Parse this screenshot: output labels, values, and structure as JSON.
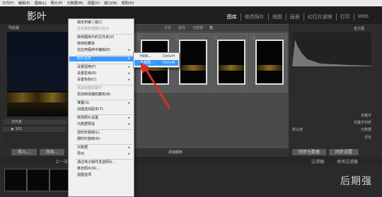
{
  "menubar": [
    "文件(F)",
    "编辑(E)",
    "图库(L)",
    "照片(P)",
    "元数据(M)",
    "视图(V)",
    "窗口(W)",
    "帮助(H)"
  ],
  "app_logo": "影叶",
  "modules": [
    {
      "label": "图库",
      "active": true
    },
    {
      "label": "修改照片",
      "active": false
    },
    {
      "label": "地图",
      "active": false
    },
    {
      "label": "画册",
      "active": false
    },
    {
      "label": "幻灯片放映",
      "active": false
    },
    {
      "label": "打印",
      "active": false
    },
    {
      "label": "Web",
      "active": false
    }
  ],
  "left_panel": {
    "navigator_title": "导航器",
    "folders_title": "文件夹",
    "folder_item": "101"
  },
  "left_buttons": [
    "导入...",
    "导出..."
  ],
  "filter_labels": [
    "文本",
    "属性",
    "元数据",
    "无"
  ],
  "grid_numbers": [
    "1",
    "2",
    "3",
    "4"
  ],
  "right_panel": {
    "histogram_title": "直方图",
    "keywords": "关键字",
    "keyword_list": "关键字列表",
    "metadata": "元数据",
    "comments": "评论",
    "default_label": "默认值"
  },
  "right_buttons": [
    "同步元数据",
    "同步设置"
  ],
  "toolbar": {
    "sort_label": "添加顺序"
  },
  "filmstrip": {
    "prev_label": "上一次导入",
    "filter_label": "过滤器:",
    "filter_value": "关闭过滤器"
  },
  "watermark": "后期强",
  "context_menu": [
    {
      "label": "锁定到第二窗口"
    },
    {
      "label": "在资源管理器中显示",
      "disabled": true
    },
    {
      "label": "转到图库中的文件夹(V)"
    },
    {
      "label": "转到收藏夹"
    },
    {
      "label": "在应用程序中编辑(E)",
      "arrow": true
    },
    {
      "label": "照片合并",
      "arrow": true,
      "highlight": true
    },
    {
      "label": "设置留用(F)",
      "arrow": true
    },
    {
      "label": "设置星级(R)",
      "arrow": true
    },
    {
      "label": "设置色标(C)",
      "arrow": true
    },
    {
      "label": "添加快捷关键字",
      "disabled": true
    },
    {
      "label": "添加到快捷收藏夹(B)"
    },
    {
      "label": "堆叠(S)",
      "arrow": true
    },
    {
      "label": "创建虚拟副本(T)"
    },
    {
      "label": "修改照片设置",
      "arrow": true
    },
    {
      "label": "元数据预设",
      "arrow": true
    },
    {
      "label": "逆时针旋转(L)"
    },
    {
      "label": "顺时针旋转(R)"
    },
    {
      "label": "元数据",
      "arrow": true
    },
    {
      "label": "导出",
      "arrow": true
    },
    {
      "label": "通过电子邮件发送照片..."
    },
    {
      "label": "移去照片(R)..."
    },
    {
      "label": "视图选项"
    }
  ],
  "submenu": [
    {
      "label": "HDR...",
      "shortcut": "Ctrl+H"
    },
    {
      "label": "全景图...",
      "shortcut": "Ctrl+M",
      "highlight": true
    }
  ],
  "colors": {
    "highlight": "#3399ff",
    "arrow": "#d93025"
  }
}
